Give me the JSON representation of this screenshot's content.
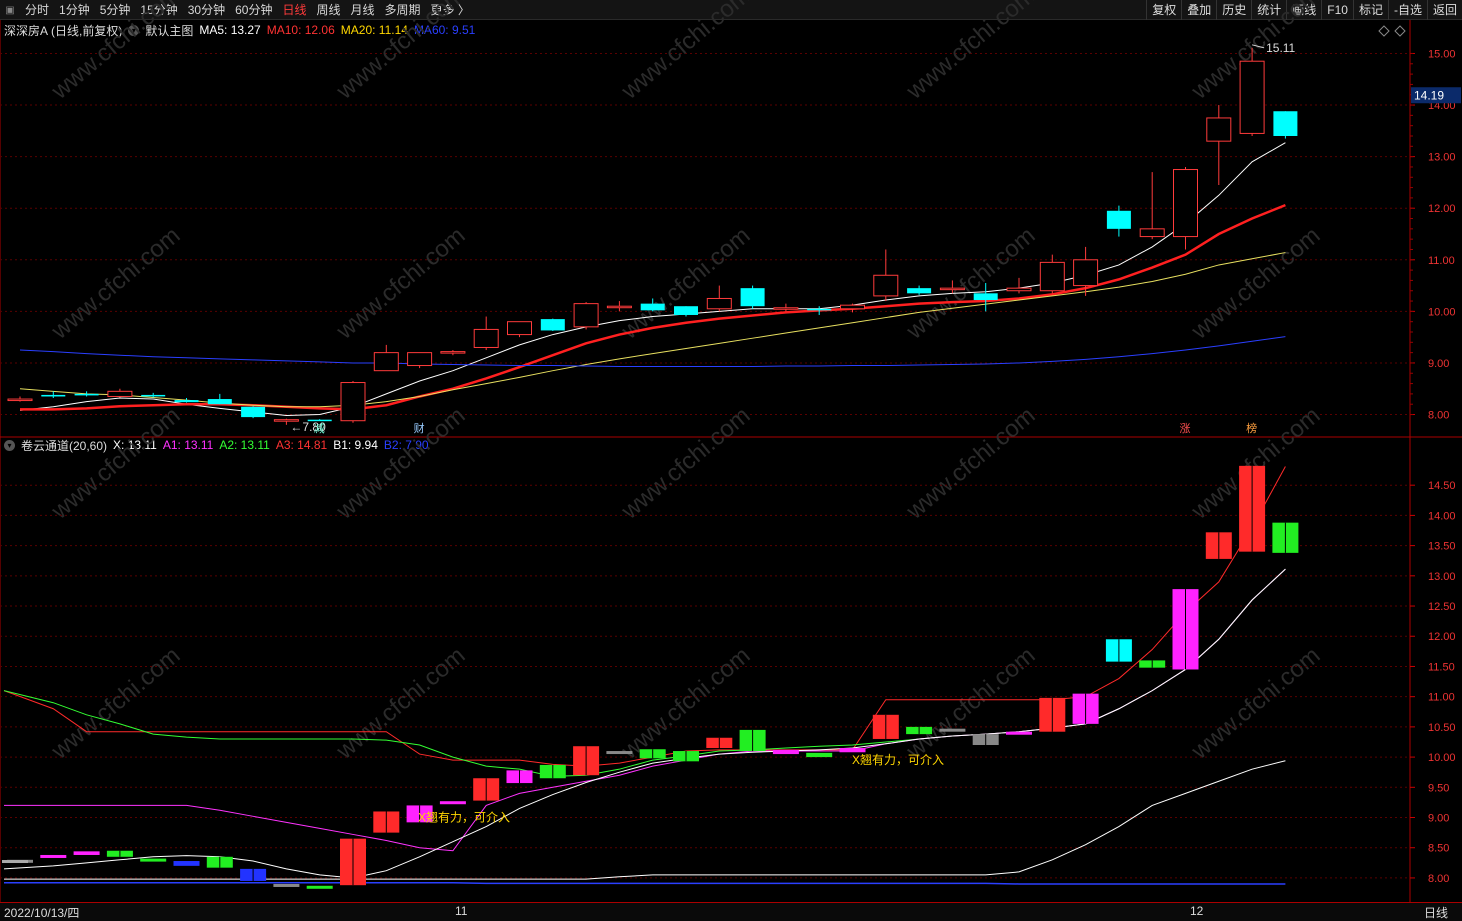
{
  "toolbar": {
    "periods": [
      "分时",
      "1分钟",
      "5分钟",
      "15分钟",
      "30分钟",
      "60分钟",
      "日线",
      "周线",
      "月线",
      "多周期",
      "更多 〉"
    ],
    "active_period": "日线",
    "right_buttons": [
      "复权",
      "叠加",
      "历史",
      "统计",
      "画线",
      "F10",
      "标记",
      "-自选",
      "返回"
    ]
  },
  "main_chart": {
    "stock": "深深房A",
    "adj": "(日线,前复权)",
    "template": "默认主图",
    "ma": [
      {
        "label": "MA5: 13.27",
        "color": "#ffffff"
      },
      {
        "label": "MA10: 12.06",
        "color": "#ff3333"
      },
      {
        "label": "MA20: 11.14",
        "color": "#ffd700"
      },
      {
        "label": "MA60: 9.51",
        "color": "#2a3fff"
      }
    ],
    "y_ticks": [
      "15.00",
      "14.00",
      "13.00",
      "12.00",
      "11.00",
      "10.00",
      "9.00",
      "8.00"
    ],
    "current_price": "14.19",
    "high_label": "15.11",
    "low_label": "7.80",
    "markers": [
      "减",
      "财",
      "涨",
      "榜"
    ]
  },
  "indicator": {
    "name": "卷云通道(20,60)",
    "values": [
      {
        "label": "X: 13.11",
        "color": "#ffffff"
      },
      {
        "label": "A1: 13.11",
        "color": "#ff33ff"
      },
      {
        "label": "A2: 13.11",
        "color": "#33ff33"
      },
      {
        "label": "A3: 14.81",
        "color": "#ff3333"
      },
      {
        "label": "B1: 9.94",
        "color": "#ffffff"
      },
      {
        "label": "B2: 7.90",
        "color": "#2a3fff"
      }
    ],
    "y_ticks": [
      "14.50",
      "14.00",
      "13.50",
      "13.00",
      "12.50",
      "12.00",
      "11.50",
      "11.00",
      "10.50",
      "10.00",
      "9.50",
      "9.00",
      "8.50",
      "8.00"
    ],
    "annotations": [
      "X翘有力，可介入",
      "X翘有力，可介入"
    ]
  },
  "bottom": {
    "date": "2022/10/13/四",
    "month_labels": [
      "11",
      "12"
    ],
    "period": "日线"
  },
  "watermark": "www.cfchi.com",
  "chart_data": [
    {
      "type": "candlestick",
      "title": "深深房A (日线,前复权)",
      "ylim": [
        7.7,
        15.3
      ],
      "candles": [
        {
          "o": 8.3,
          "h": 8.35,
          "l": 8.25,
          "c": 8.3
        },
        {
          "o": 8.38,
          "h": 8.45,
          "l": 8.32,
          "c": 8.35
        },
        {
          "o": 8.4,
          "h": 8.45,
          "l": 8.35,
          "c": 8.38
        },
        {
          "o": 8.35,
          "h": 8.5,
          "l": 8.33,
          "c": 8.45
        },
        {
          "o": 8.38,
          "h": 8.42,
          "l": 8.33,
          "c": 8.37
        },
        {
          "o": 8.28,
          "h": 8.32,
          "l": 8.23,
          "c": 8.24
        },
        {
          "o": 8.3,
          "h": 8.4,
          "l": 8.2,
          "c": 8.2
        },
        {
          "o": 8.15,
          "h": 8.16,
          "l": 7.93,
          "c": 7.95
        },
        {
          "o": 7.9,
          "h": 7.92,
          "l": 7.8,
          "c": 7.9
        },
        {
          "o": 7.9,
          "h": 7.91,
          "l": 7.88,
          "c": 7.89
        },
        {
          "o": 7.88,
          "h": 8.65,
          "l": 7.84,
          "c": 8.62
        },
        {
          "o": 8.85,
          "h": 9.35,
          "l": 8.85,
          "c": 9.2
        },
        {
          "o": 8.95,
          "h": 9.2,
          "l": 8.9,
          "c": 9.2
        },
        {
          "o": 9.2,
          "h": 9.25,
          "l": 9.15,
          "c": 9.22
        },
        {
          "o": 9.3,
          "h": 9.9,
          "l": 9.25,
          "c": 9.65
        },
        {
          "o": 9.55,
          "h": 9.8,
          "l": 9.5,
          "c": 9.8
        },
        {
          "o": 9.85,
          "h": 9.86,
          "l": 9.62,
          "c": 9.63
        },
        {
          "o": 9.7,
          "h": 10.18,
          "l": 9.65,
          "c": 10.15
        },
        {
          "o": 10.1,
          "h": 10.2,
          "l": 10.0,
          "c": 10.1
        },
        {
          "o": 10.15,
          "h": 10.25,
          "l": 10.0,
          "c": 10.02
        },
        {
          "o": 10.1,
          "h": 10.1,
          "l": 9.9,
          "c": 9.93
        },
        {
          "o": 10.05,
          "h": 10.5,
          "l": 10.0,
          "c": 10.25
        },
        {
          "o": 10.45,
          "h": 10.5,
          "l": 10.05,
          "c": 10.1
        },
        {
          "o": 10.05,
          "h": 10.15,
          "l": 10.0,
          "c": 10.07
        },
        {
          "o": 10.05,
          "h": 10.1,
          "l": 9.93,
          "c": 10.02
        },
        {
          "o": 10.05,
          "h": 10.15,
          "l": 9.98,
          "c": 10.12
        },
        {
          "o": 10.3,
          "h": 11.2,
          "l": 10.2,
          "c": 10.7
        },
        {
          "o": 10.45,
          "h": 10.5,
          "l": 10.32,
          "c": 10.35
        },
        {
          "o": 10.45,
          "h": 10.6,
          "l": 10.35,
          "c": 10.45
        },
        {
          "o": 10.35,
          "h": 10.55,
          "l": 10.0,
          "c": 10.22
        },
        {
          "o": 10.4,
          "h": 10.65,
          "l": 10.35,
          "c": 10.45
        },
        {
          "o": 10.4,
          "h": 11.1,
          "l": 10.35,
          "c": 10.95
        },
        {
          "o": 10.5,
          "h": 11.25,
          "l": 10.3,
          "c": 11.0
        },
        {
          "o": 11.95,
          "h": 12.05,
          "l": 11.45,
          "c": 11.6
        },
        {
          "o": 11.45,
          "h": 12.7,
          "l": 11.4,
          "c": 11.6
        },
        {
          "o": 11.45,
          "h": 12.8,
          "l": 11.2,
          "c": 12.75
        },
        {
          "o": 13.3,
          "h": 14.0,
          "l": 12.45,
          "c": 13.75
        },
        {
          "o": 13.45,
          "h": 15.11,
          "l": 13.4,
          "c": 14.85
        },
        {
          "o": 13.88,
          "h": 13.88,
          "l": 13.35,
          "c": 13.4
        }
      ],
      "series": [
        {
          "name": "MA5",
          "values": [
            8.08,
            8.15,
            8.25,
            8.32,
            8.3,
            8.2,
            8.12,
            8.05,
            7.98,
            8.0,
            8.15,
            8.4,
            8.65,
            8.85,
            9.1,
            9.35,
            9.55,
            9.7,
            9.82,
            9.9,
            9.95,
            10.0,
            10.05,
            10.05,
            10.05,
            10.12,
            10.22,
            10.3,
            10.35,
            10.38,
            10.45,
            10.55,
            10.7,
            10.9,
            11.25,
            11.7,
            12.25,
            12.9,
            13.27
          ]
        },
        {
          "name": "MA10",
          "values": [
            8.1,
            8.1,
            8.12,
            8.16,
            8.18,
            8.2,
            8.2,
            8.18,
            8.15,
            8.12,
            8.1,
            8.18,
            8.35,
            8.5,
            8.7,
            8.92,
            9.15,
            9.38,
            9.55,
            9.68,
            9.78,
            9.86,
            9.92,
            9.98,
            10.02,
            10.05,
            10.1,
            10.15,
            10.18,
            10.2,
            10.25,
            10.33,
            10.45,
            10.62,
            10.85,
            11.1,
            11.5,
            11.8,
            12.06
          ]
        },
        {
          "name": "MA20",
          "values": [
            8.5,
            8.45,
            8.4,
            8.38,
            8.33,
            8.28,
            8.22,
            8.18,
            8.15,
            8.15,
            8.18,
            8.25,
            8.35,
            8.48,
            8.6,
            8.72,
            8.85,
            8.97,
            9.08,
            9.18,
            9.28,
            9.38,
            9.48,
            9.58,
            9.68,
            9.78,
            9.88,
            9.98,
            10.06,
            10.14,
            10.22,
            10.3,
            10.38,
            10.47,
            10.58,
            10.72,
            10.9,
            11.02,
            11.14
          ]
        },
        {
          "name": "MA60",
          "values": [
            9.25,
            9.22,
            9.18,
            9.15,
            9.12,
            9.1,
            9.08,
            9.06,
            9.04,
            9.02,
            9.0,
            9.0,
            8.98,
            8.97,
            8.96,
            8.95,
            8.95,
            8.94,
            8.93,
            8.93,
            8.93,
            8.93,
            8.93,
            8.94,
            8.94,
            8.95,
            8.95,
            8.96,
            8.97,
            8.98,
            9.0,
            9.03,
            9.07,
            9.12,
            9.18,
            9.25,
            9.33,
            9.42,
            9.51
          ]
        }
      ]
    },
    {
      "type": "candlestick",
      "title": "卷云通道(20,60)",
      "ylim": [
        7.85,
        14.95
      ],
      "candles": [
        {
          "o": 8.3,
          "c": 8.28,
          "color": "gray"
        },
        {
          "o": 8.38,
          "c": 8.35,
          "color": "magenta"
        },
        {
          "o": 8.44,
          "c": 8.38,
          "color": "magenta"
        },
        {
          "o": 8.35,
          "c": 8.45,
          "color": "green"
        },
        {
          "o": 8.32,
          "c": 8.3,
          "color": "green"
        },
        {
          "o": 8.28,
          "c": 8.2,
          "color": "blue"
        },
        {
          "o": 8.35,
          "c": 8.17,
          "color": "green"
        },
        {
          "o": 8.15,
          "c": 7.95,
          "color": "blue"
        },
        {
          "o": 7.9,
          "c": 7.88,
          "color": "gray"
        },
        {
          "o": 7.87,
          "c": 7.86,
          "color": "green"
        },
        {
          "o": 7.88,
          "c": 8.65,
          "color": "red"
        },
        {
          "o": 8.75,
          "c": 9.1,
          "color": "red"
        },
        {
          "o": 8.92,
          "c": 9.2,
          "color": "magenta"
        },
        {
          "o": 9.22,
          "c": 9.27,
          "color": "magenta"
        },
        {
          "o": 9.28,
          "c": 9.65,
          "color": "red"
        },
        {
          "o": 9.57,
          "c": 9.78,
          "color": "magenta"
        },
        {
          "o": 9.65,
          "c": 9.87,
          "color": "green"
        },
        {
          "o": 9.7,
          "c": 10.18,
          "color": "red"
        },
        {
          "o": 10.07,
          "c": 10.1,
          "color": "gray"
        },
        {
          "o": 9.98,
          "c": 10.13,
          "color": "green"
        },
        {
          "o": 9.93,
          "c": 10.1,
          "color": "green"
        },
        {
          "o": 10.15,
          "c": 10.32,
          "color": "red"
        },
        {
          "o": 10.1,
          "c": 10.45,
          "color": "green"
        },
        {
          "o": 10.05,
          "c": 10.12,
          "color": "magenta"
        },
        {
          "o": 10.0,
          "c": 10.07,
          "color": "green"
        },
        {
          "o": 10.08,
          "c": 10.15,
          "color": "magenta"
        },
        {
          "o": 10.3,
          "c": 10.7,
          "color": "red"
        },
        {
          "o": 10.38,
          "c": 10.5,
          "color": "green"
        },
        {
          "o": 10.43,
          "c": 10.47,
          "color": "gray"
        },
        {
          "o": 10.2,
          "c": 10.38,
          "color": "gray"
        },
        {
          "o": 10.38,
          "c": 10.42,
          "color": "magenta"
        },
        {
          "o": 10.42,
          "c": 10.98,
          "color": "red"
        },
        {
          "o": 10.55,
          "c": 11.05,
          "color": "magenta"
        },
        {
          "o": 11.58,
          "c": 11.95,
          "color": "cyan"
        },
        {
          "o": 11.48,
          "c": 11.6,
          "color": "green"
        },
        {
          "o": 11.45,
          "c": 12.78,
          "color": "magenta"
        },
        {
          "o": 13.28,
          "c": 13.72,
          "color": "red"
        },
        {
          "o": 13.4,
          "c": 14.82,
          "color": "red"
        },
        {
          "o": 13.88,
          "c": 13.38,
          "color": "green"
        }
      ],
      "series": [
        {
          "name": "A3",
          "values": [
            11.1,
            10.8,
            10.42,
            10.42,
            10.42,
            10.42,
            10.42,
            10.42,
            10.42,
            10.42,
            10.42,
            10.42,
            10.05,
            9.95,
            9.95,
            9.95,
            9.88,
            9.85,
            9.9,
            10.0,
            10.1,
            10.12,
            10.12,
            10.12,
            10.12,
            10.12,
            10.95,
            10.95,
            10.95,
            10.95,
            10.95,
            10.95,
            11.0,
            11.3,
            11.78,
            12.4,
            12.9,
            13.8,
            14.81
          ]
        },
        {
          "name": "A2",
          "values": [
            11.1,
            10.9,
            10.7,
            10.55,
            10.38,
            10.33,
            10.3,
            10.3,
            10.3,
            10.3,
            10.3,
            10.28,
            10.2,
            10.0,
            9.85,
            9.8,
            9.68,
            9.7,
            9.8,
            9.95,
            10.02,
            10.1,
            10.12,
            10.15,
            10.18,
            10.2,
            10.25,
            10.3,
            10.35,
            10.38,
            10.42,
            10.48,
            10.55,
            10.8,
            11.1,
            11.45,
            11.95,
            12.6,
            13.11
          ]
        },
        {
          "name": "A1",
          "values": [
            9.2,
            9.2,
            9.2,
            9.2,
            9.2,
            9.2,
            9.12,
            9.02,
            8.92,
            8.82,
            8.72,
            8.62,
            8.5,
            8.45,
            9.2,
            9.4,
            9.5,
            9.6,
            9.7,
            9.85,
            9.95,
            10.05,
            10.1,
            10.1,
            10.1,
            10.1,
            10.22,
            10.3,
            10.35,
            10.38,
            10.42,
            10.48,
            10.55,
            10.8,
            11.1,
            11.45,
            11.95,
            12.6,
            13.11
          ]
        },
        {
          "name": "X",
          "values": [
            8.15,
            8.2,
            8.25,
            8.3,
            8.35,
            8.37,
            8.35,
            8.28,
            8.15,
            8.05,
            8.0,
            8.12,
            8.35,
            8.6,
            8.85,
            9.15,
            9.38,
            9.58,
            9.75,
            9.9,
            9.98,
            10.05,
            10.08,
            10.1,
            10.12,
            10.15,
            10.22,
            10.3,
            10.35,
            10.38,
            10.42,
            10.48,
            10.55,
            10.8,
            11.1,
            11.45,
            11.95,
            12.6,
            13.11
          ]
        },
        {
          "name": "B1",
          "values": [
            7.98,
            7.98,
            7.98,
            7.98,
            7.98,
            7.98,
            7.98,
            7.98,
            7.98,
            7.98,
            7.98,
            7.98,
            7.98,
            7.98,
            7.98,
            7.98,
            7.98,
            7.98,
            8.02,
            8.05,
            8.05,
            8.05,
            8.05,
            8.05,
            8.05,
            8.05,
            8.05,
            8.05,
            8.05,
            8.05,
            8.1,
            8.3,
            8.55,
            8.85,
            9.2,
            9.4,
            9.6,
            9.8,
            9.94
          ]
        },
        {
          "name": "B2",
          "values": [
            7.92,
            7.92,
            7.92,
            7.92,
            7.92,
            7.92,
            7.92,
            7.92,
            7.92,
            7.92,
            7.92,
            7.92,
            7.92,
            7.92,
            7.91,
            7.91,
            7.91,
            7.91,
            7.91,
            7.91,
            7.91,
            7.91,
            7.91,
            7.91,
            7.91,
            7.91,
            7.91,
            7.91,
            7.91,
            7.91,
            7.9,
            7.9,
            7.9,
            7.9,
            7.9,
            7.9,
            7.9,
            7.9,
            7.9
          ]
        }
      ]
    }
  ]
}
